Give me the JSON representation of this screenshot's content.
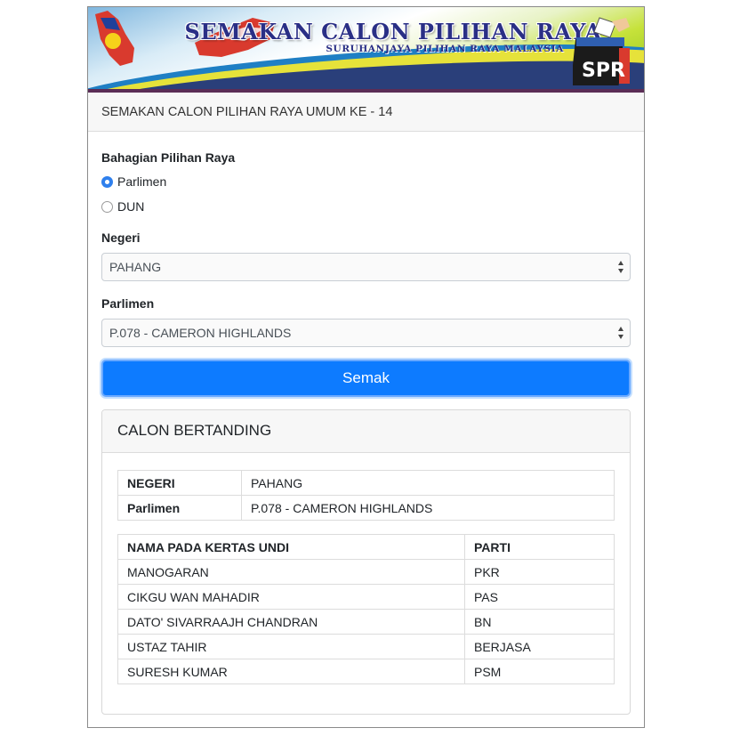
{
  "banner": {
    "title": "SEMAKAN CALON PILIHAN RAYA",
    "subtitle": "SURUHANJAYA PILIHAN RAYA MALAYSIA",
    "logo_text": "SPR"
  },
  "header": {
    "title": "SEMAKAN CALON PILIHAN RAYA UMUM KE - 14"
  },
  "form": {
    "bahagian_label": "Bahagian Pilihan Raya",
    "options": [
      {
        "label": "Parlimen",
        "checked": true
      },
      {
        "label": "DUN",
        "checked": false
      }
    ],
    "negeri_label": "Negeri",
    "negeri_value": "PAHANG",
    "parlimen_label": "Parlimen",
    "parlimen_value": "P.078 - CAMERON HIGHLANDS",
    "submit_label": "Semak"
  },
  "result": {
    "title": "CALON BERTANDING",
    "info": [
      {
        "key": "NEGERI",
        "value": "PAHANG"
      },
      {
        "key": "Parlimen",
        "value": "P.078 - CAMERON HIGHLANDS"
      }
    ],
    "columns": [
      "NAMA PADA KERTAS UNDI",
      "PARTI"
    ],
    "candidates": [
      {
        "name": "MANOGARAN",
        "party": "PKR"
      },
      {
        "name": "CIKGU WAN MAHADIR",
        "party": "PAS"
      },
      {
        "name": "DATO' SIVARRAAJH CHANDRAN",
        "party": "BN"
      },
      {
        "name": "USTAZ TAHIR",
        "party": "BERJASA"
      },
      {
        "name": "SURESH KUMAR",
        "party": "PSM"
      }
    ]
  },
  "colors": {
    "primary": "#0d7bff",
    "banner_rule": "#5b2d56",
    "title_ink": "#2a2f86"
  }
}
